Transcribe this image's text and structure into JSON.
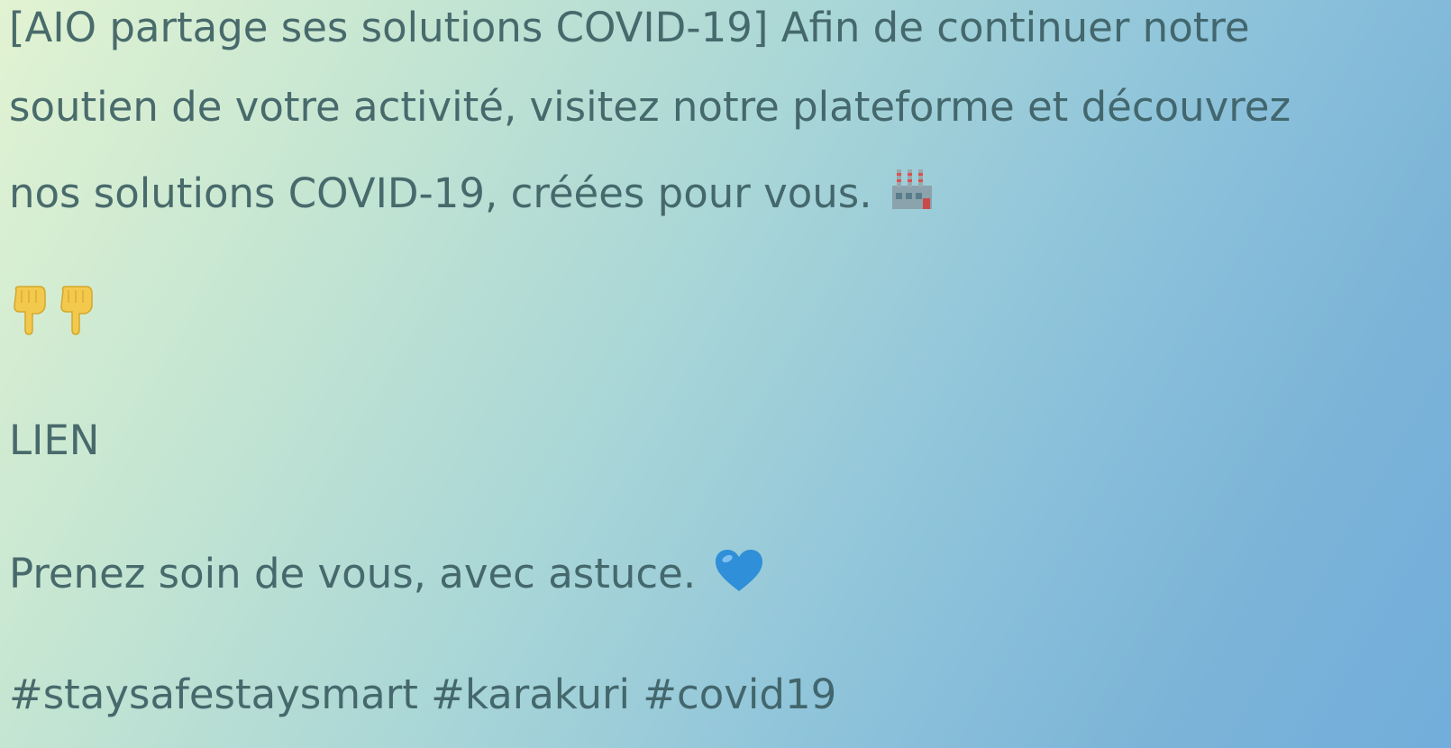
{
  "post": {
    "line1": "[AIO partage ses solutions COVID-19] Afin de continuer notre",
    "line2": "soutien de votre activité, visitez notre plateforme et découvrez",
    "line3": "nos solutions COVID-19, créées pour vous.",
    "line3_icon": "factory-icon",
    "pointing_icons": [
      "backhand-index-pointing-down-icon",
      "backhand-index-pointing-down-icon"
    ],
    "link_label": "LIEN",
    "care_line": "Prenez soin de vous, avec astuce.",
    "care_icon": "blue-heart-icon",
    "hashtags": "#staysafestaysmart #karakuri #covid19"
  },
  "colors": {
    "text": "#3a5c60",
    "heart": "#2f8fd8",
    "hand": "#f2c94c"
  }
}
